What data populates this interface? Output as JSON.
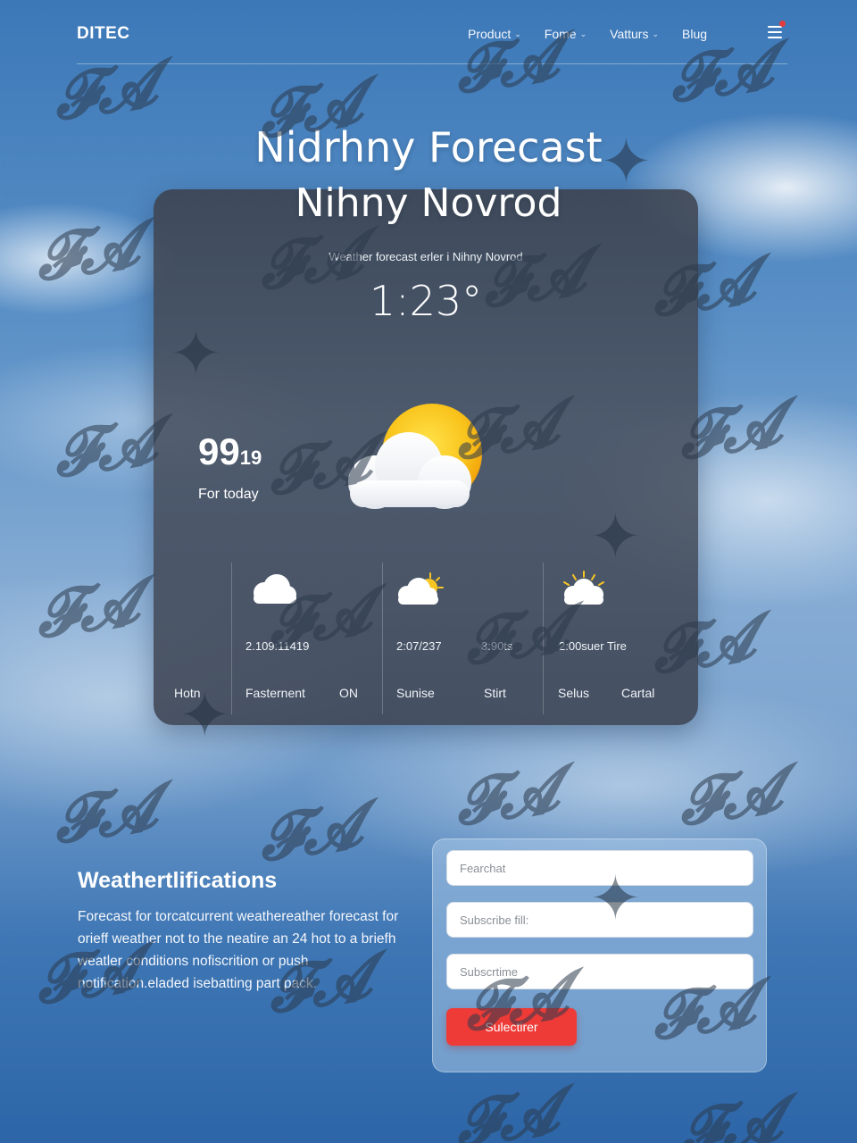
{
  "nav": {
    "brand": "DITEC",
    "items": [
      {
        "label": "Product",
        "chevron": "chevron-down-icon"
      },
      {
        "label": "Fome",
        "chevron": "chevron-down-icon"
      },
      {
        "label": "Vatturs",
        "chevron": "chevron-down-icon"
      },
      {
        "label": "Blug"
      }
    ],
    "menu_icon": "hamburger-icon",
    "notification_color": "#e23c3c"
  },
  "hero": {
    "title": "Nidrhny Forecast",
    "subtitle": "Nihny Novrod"
  },
  "card": {
    "caption": "Weather forecast erler i Nihny Novrod",
    "time": "1:23°",
    "temperature": "99",
    "temperature_suffix": "19",
    "temperature_label": "For today",
    "main_icon": "sun-behind-cloud-icon",
    "columns": [
      {
        "label": "Hotn"
      },
      {
        "icon": "cloud-icon",
        "value": "2.109:11419",
        "label": "Fasternent",
        "label2": "ON"
      },
      {
        "icon": "partly-sunny-icon",
        "value": "2:07/237",
        "value2": "3:90ts",
        "label": "Sunise",
        "label2": "Stirt"
      },
      {
        "icon": "sun-rays-cloud-icon",
        "value": "2:00suer Tire",
        "label": "Selus",
        "label2": "Cartal"
      }
    ]
  },
  "notifications": {
    "title": "Weathertlifications",
    "body": "Forecast for torcatcurrent weathereather forecast for orieff weather not to the neatire an 24 hot to a briefh weatler conditions nofiscrition or push notification.eladed isebatting part pack."
  },
  "form": {
    "field1_placeholder": "Fearchat",
    "field2_placeholder": "Subscribe fill:",
    "field3_placeholder": "Subscrtime",
    "submit_label": "Sulectirer",
    "accent_color": "#ee3b37"
  }
}
